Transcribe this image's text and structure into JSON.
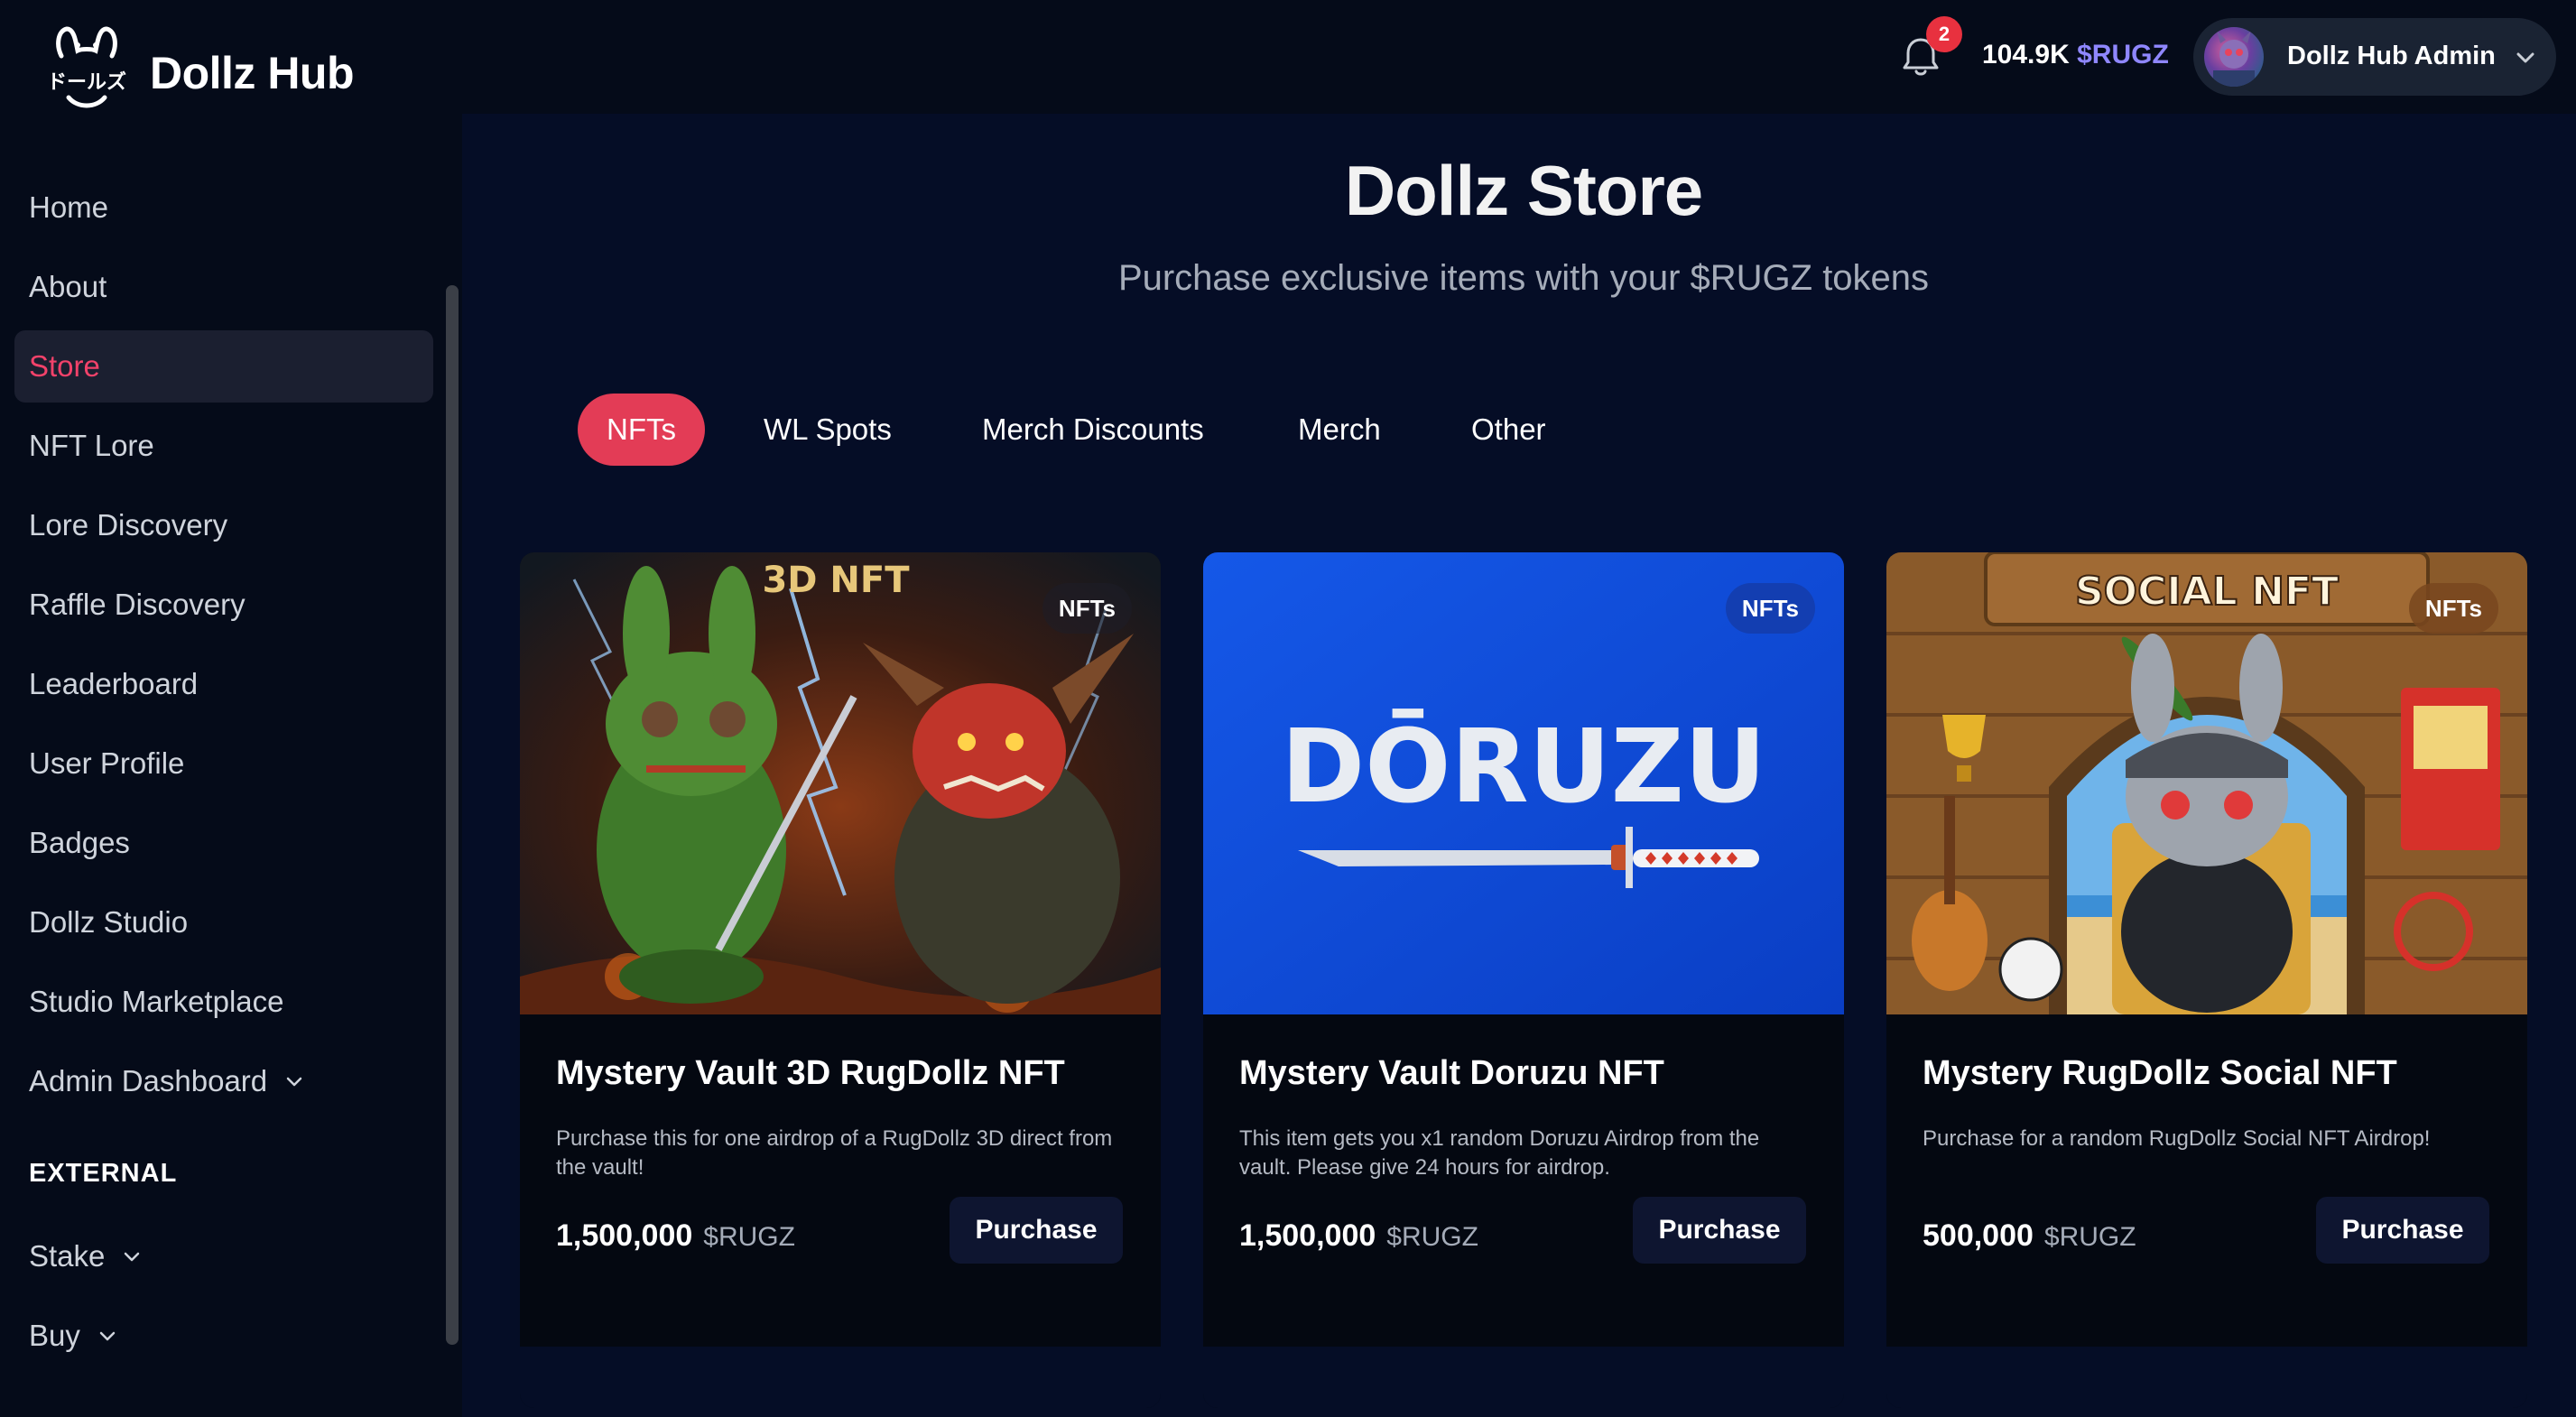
{
  "app": {
    "brand": "Dollz Hub"
  },
  "header": {
    "notifications_count": "2",
    "balance_amount": "104.9K",
    "balance_token": "$RUGZ",
    "user_name": "Dollz Hub Admin"
  },
  "sidebar": {
    "items": [
      {
        "label": "Home"
      },
      {
        "label": "About"
      },
      {
        "label": "Store"
      },
      {
        "label": "NFT Lore"
      },
      {
        "label": "Lore Discovery"
      },
      {
        "label": "Raffle Discovery"
      },
      {
        "label": "Leaderboard"
      },
      {
        "label": "User Profile"
      },
      {
        "label": "Badges"
      },
      {
        "label": "Dollz Studio"
      },
      {
        "label": "Studio Marketplace"
      },
      {
        "label": "Admin Dashboard"
      }
    ],
    "section_external": "EXTERNAL",
    "external_items": [
      {
        "label": "Stake"
      },
      {
        "label": "Buy"
      }
    ]
  },
  "main": {
    "title": "Dollz Store",
    "subtitle": "Purchase exclusive items with your $RUGZ tokens",
    "tabs": [
      {
        "label": "NFTs"
      },
      {
        "label": "WL Spots"
      },
      {
        "label": "Merch Discounts"
      },
      {
        "label": "Merch"
      },
      {
        "label": "Other"
      }
    ]
  },
  "cards": [
    {
      "image_text": "3D NFT",
      "tag": "NFTs",
      "title": "Mystery Vault 3D RugDollz NFT",
      "description": "Purchase this for one airdrop of a RugDollz 3D direct from the vault!",
      "price": "1,500,000",
      "unit": "$RUGZ",
      "button": "Purchase"
    },
    {
      "image_text": "DŌRUZU",
      "tag": "NFTs",
      "title": "Mystery Vault Doruzu NFT",
      "description": "This item gets you x1 random Doruzu Airdrop from the vault. Please give 24 hours for airdrop.",
      "price": "1,500,000",
      "unit": "$RUGZ",
      "button": "Purchase"
    },
    {
      "image_text": "SOCIAL NFT",
      "tag": "NFTs",
      "title": "Mystery RugDollz Social NFT",
      "description": "Purchase for a random RugDollz Social NFT Airdrop!",
      "price": "500,000",
      "unit": "$RUGZ",
      "button": "Purchase"
    }
  ],
  "colors": {
    "accent": "#e33c56",
    "active_nav": "#f2426a",
    "token": "#8f87ff",
    "background": "#050d26",
    "sidebar": "#050b19"
  }
}
